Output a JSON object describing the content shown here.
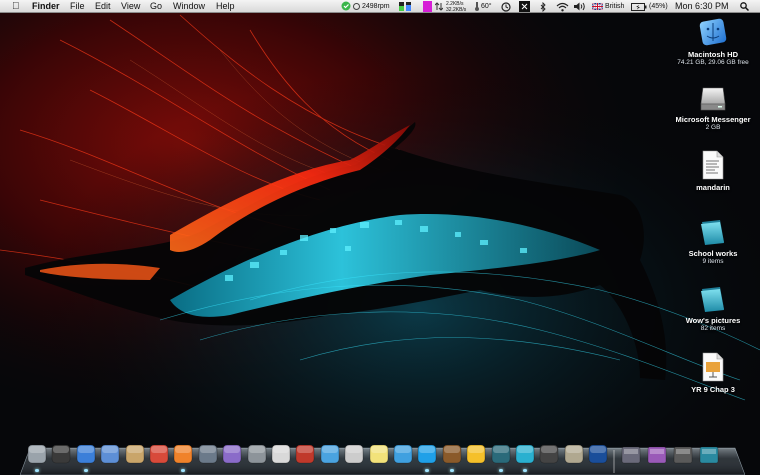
{
  "menubar": {
    "apple_icon": "apple-logo-icon",
    "app_name": "Finder",
    "menus": [
      "File",
      "Edit",
      "View",
      "Go",
      "Window",
      "Help"
    ],
    "fan_speed": "2498rpm",
    "net_up": "2.2KB/s",
    "net_down": "32.2KB/s",
    "temperature": "60°",
    "language": "British",
    "battery": "(45%)",
    "clock": "Mon 6:30 PM"
  },
  "desktop_icons": [
    {
      "label": "Macintosh HD",
      "sub": "74.21 GB, 29.06 GB free",
      "icon": "finder-disk-icon"
    },
    {
      "label": "Microsoft Messenger",
      "sub": "2 GB",
      "icon": "external-drive-icon"
    },
    {
      "label": "mandarin",
      "sub": "",
      "icon": "document-icon"
    },
    {
      "label": "School works",
      "sub": "9 items",
      "icon": "folder-icon"
    },
    {
      "label": "Wow's pictures",
      "sub": "82 items",
      "icon": "folder-icon"
    },
    {
      "label": "YR 9 Chap 3",
      "sub": "",
      "icon": "presentation-icon"
    }
  ],
  "dock": {
    "apps": [
      "finder",
      "dashboard",
      "safari",
      "mail",
      "address-book",
      "ical",
      "firefox",
      "preview",
      "inkscape",
      "system-preferences",
      "textedit",
      "photo-booth",
      "itunes",
      "chess",
      "stickies",
      "messenger",
      "skype",
      "world-of-warcraft",
      "adium",
      "time-machine",
      "avatar",
      "spy",
      "script-editor",
      "photoshop"
    ],
    "right_items": [
      "applications-stack",
      "documents-stack",
      "downloads-stack",
      "trash"
    ],
    "colors": {
      "accent": "#2ad4f0",
      "fire": "#ff3a12"
    }
  }
}
